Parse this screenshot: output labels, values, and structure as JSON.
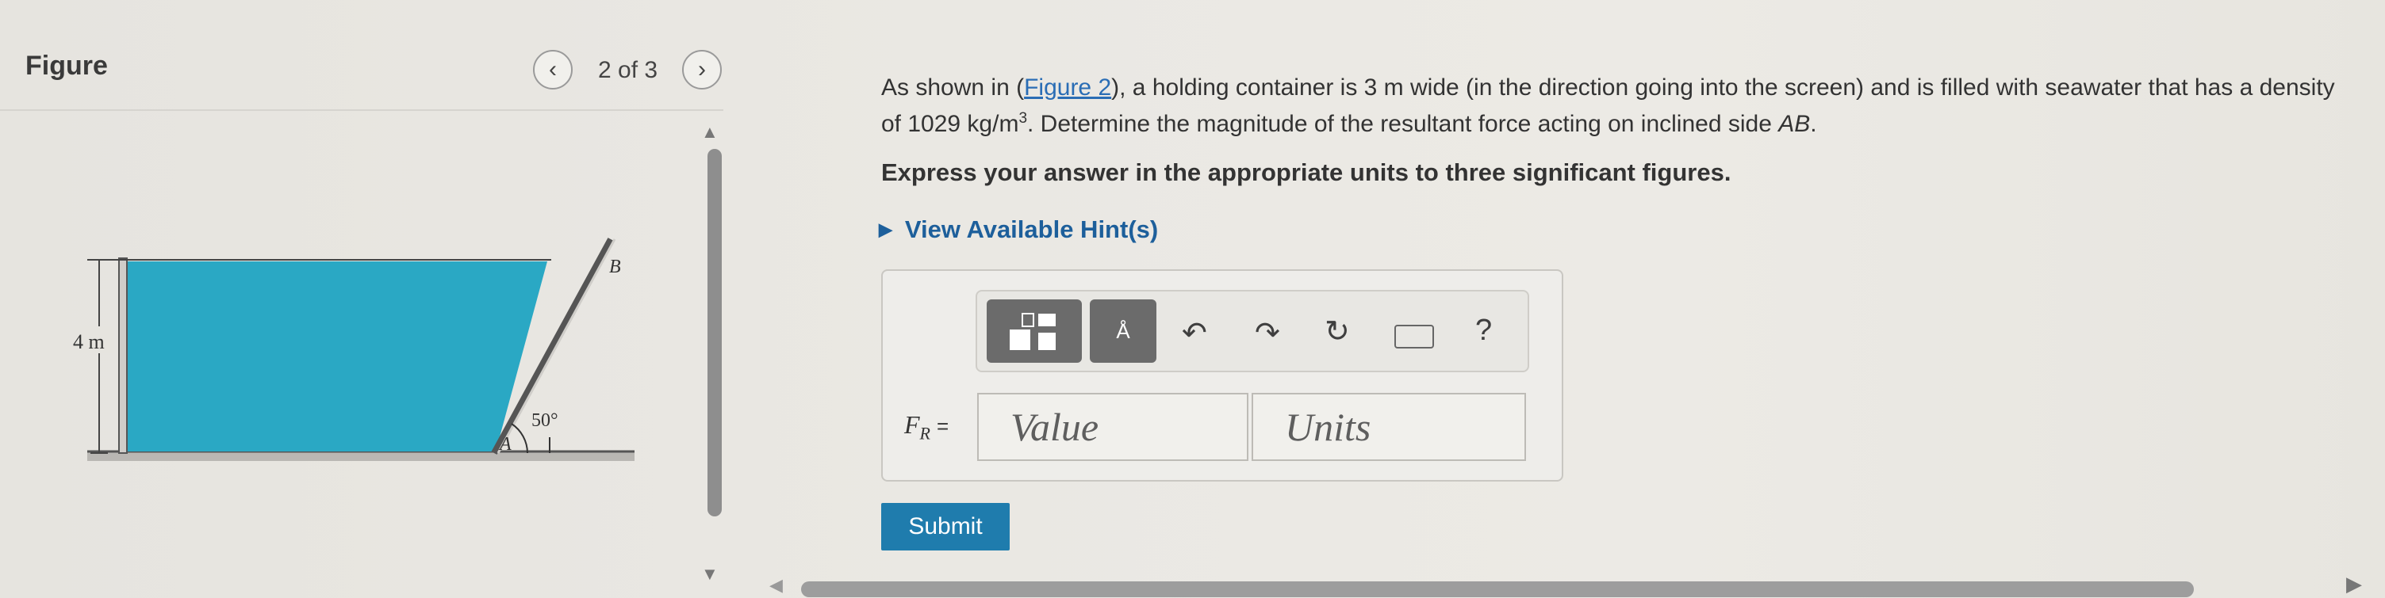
{
  "figure_panel": {
    "title": "Figure",
    "prev_icon": "chevron-left-icon",
    "next_icon": "chevron-right-icon",
    "page_counter": "2 of 3",
    "diagram": {
      "depth_label": "4 m",
      "angle_label": "50°",
      "point_a": "A",
      "point_b": "B",
      "water_color": "#2aa8c4"
    }
  },
  "problem": {
    "text_before_link": "As shown in (",
    "figure_link": "Figure 2",
    "text_after_link": "), a holding container is 3 m wide (in the direction going into the screen) and is filled with seawater that has a density of 1029 kg/m",
    "unit_exponent": "3",
    "text_tail": ". Determine the magnitude of the resultant force acting on inclined side ",
    "side_name": "AB",
    "text_end": ".",
    "instruction": "Express your answer in the appropriate units to three significant figures.",
    "hints_label": "View Available Hint(s)"
  },
  "answer": {
    "variable": "F",
    "variable_subscript": "R",
    "equals": "=",
    "value_placeholder": "Value",
    "units_placeholder": "Units",
    "submit_label": "Submit",
    "toolbar": {
      "units_symbol": "Å",
      "help_label": "?"
    }
  },
  "colors": {
    "accent": "#1f7cad",
    "link": "#2a6db5"
  }
}
